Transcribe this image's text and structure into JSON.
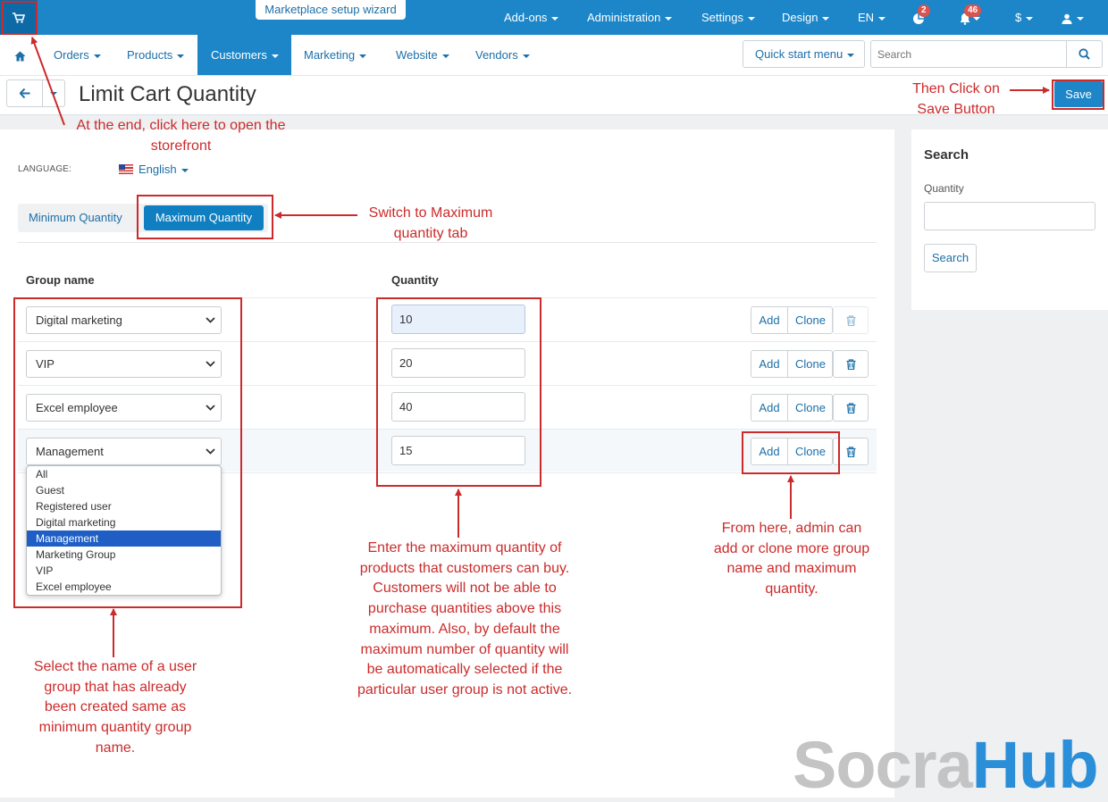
{
  "topbar": {
    "wizard_label": "Marketplace setup wizard",
    "menus": [
      {
        "label": "Add-ons"
      },
      {
        "label": "Administration"
      },
      {
        "label": "Settings"
      },
      {
        "label": "Design"
      },
      {
        "label": "EN"
      }
    ],
    "orders_badge": "2",
    "notifications_badge": "46",
    "currency": "$"
  },
  "nav": {
    "items": [
      {
        "label": "Orders"
      },
      {
        "label": "Products"
      },
      {
        "label": "Customers"
      },
      {
        "label": "Marketing"
      },
      {
        "label": "Website"
      },
      {
        "label": "Vendors"
      }
    ],
    "quick_start": "Quick start menu",
    "search_placeholder": "Search"
  },
  "page": {
    "title": "Limit Cart Quantity",
    "save_label": "Save"
  },
  "language": {
    "label": "LANGUAGE:",
    "value": "English"
  },
  "tabs": {
    "min": "Minimum Quantity",
    "max": "Maximum Quantity"
  },
  "table": {
    "headers": {
      "group": "Group name",
      "quantity": "Quantity"
    },
    "rows": [
      {
        "group": "Digital marketing",
        "quantity": "10"
      },
      {
        "group": "VIP",
        "quantity": "20"
      },
      {
        "group": "Excel employee",
        "quantity": "40"
      },
      {
        "group": "Management",
        "quantity": "15"
      }
    ],
    "add_label": "Add",
    "clone_label": "Clone"
  },
  "dropdown": {
    "options": [
      "All",
      "Guest",
      "Registered user",
      "Digital marketing",
      "Management",
      "Marketing Group",
      "VIP",
      "Excel employee"
    ],
    "selected": "Management"
  },
  "sidebar": {
    "title": "Search",
    "quantity_label": "Quantity",
    "search_button": "Search"
  },
  "annotations": {
    "storefront": "At the end, click here to open the storefront",
    "save": "Then Click on Save Button",
    "switch_tab": "Switch to Maximum quantity tab",
    "select_group": "Select the name of a user group that has already been created same as minimum quantity group name.",
    "enter_max": "Enter the maximum quantity of products that customers can buy. Customers will not be able to purchase quantities above this maximum. Also, by default the maximum number of quantity will be automatically selected if the particular user group is not active.",
    "add_clone": "From here, admin can add or clone more group name and maximum quantity."
  },
  "brand": {
    "part1": "Socra",
    "part2": "Hub"
  },
  "colors": {
    "accent": "#1c86c8",
    "annotation": "#cc2b2b",
    "selected_option": "#1f5fc5"
  }
}
